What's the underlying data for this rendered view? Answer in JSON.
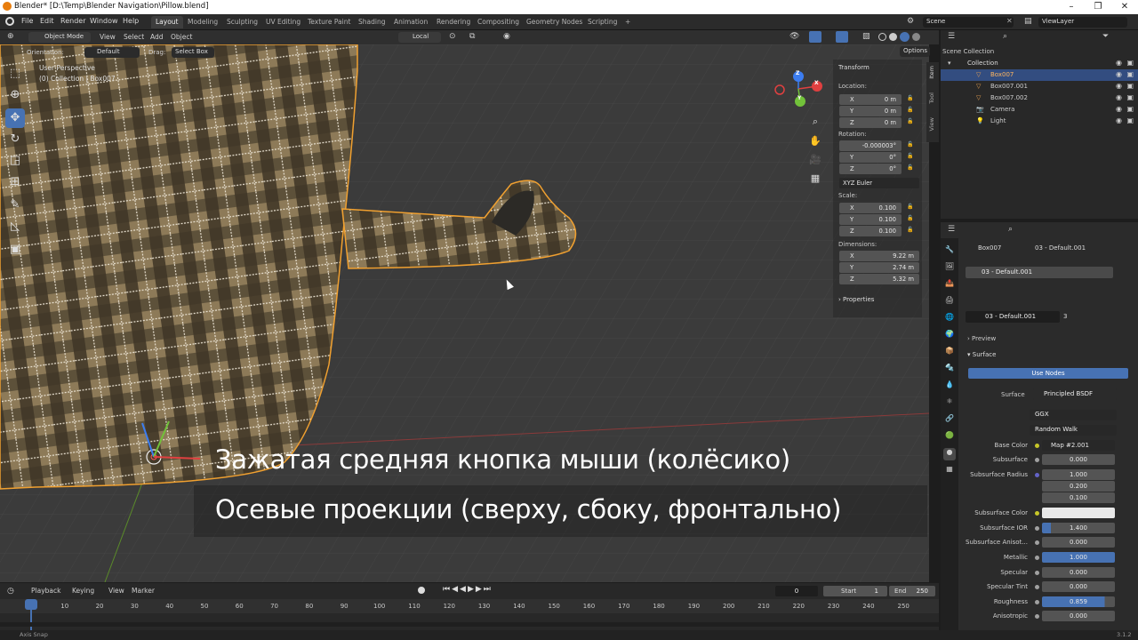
{
  "window": {
    "title": "Blender* [D:\\Temp\\Blender Navigation\\Pillow.blend]"
  },
  "menu": {
    "items": [
      "File",
      "Edit",
      "Render",
      "Window",
      "Help"
    ]
  },
  "workspaces": [
    "Layout",
    "Modeling",
    "Sculpting",
    "UV Editing",
    "Texture Paint",
    "Shading",
    "Animation",
    "Rendering",
    "Compositing",
    "Geometry Nodes",
    "Scripting"
  ],
  "topbar": {
    "add_tab": "+",
    "scene": "Scene",
    "view_layer": "ViewLayer"
  },
  "viewport_header": {
    "mode": "Object Mode",
    "menus": [
      "View",
      "Select",
      "Add",
      "Object"
    ],
    "transform_orientation": "Local",
    "orientation_label": "Orientation:",
    "orientation_value": "Default",
    "drag_label": "Drag:",
    "drag_value": "Select Box",
    "options": "Options"
  },
  "viewport": {
    "perspective": "User Perspective",
    "collection_info": "(0) Collection | Box007",
    "gizmo_axes": {
      "x": "X",
      "y": "Y",
      "z": "Z"
    }
  },
  "npanel": {
    "tabs": [
      "Item",
      "Tool",
      "View"
    ],
    "section": "Transform",
    "location_label": "Location:",
    "location": [
      {
        "axis": "X",
        "value": "0 m"
      },
      {
        "axis": "Y",
        "value": "0 m"
      },
      {
        "axis": "Z",
        "value": "0 m"
      }
    ],
    "rotation_label": "Rotation:",
    "rotation": [
      {
        "axis": "",
        "value": "-0.000003°"
      },
      {
        "axis": "Y",
        "value": "0°"
      },
      {
        "axis": "Z",
        "value": "0°"
      }
    ],
    "rotation_mode": "XYZ Euler",
    "scale_label": "Scale:",
    "scale": [
      {
        "axis": "X",
        "value": "0.100"
      },
      {
        "axis": "Y",
        "value": "0.100"
      },
      {
        "axis": "Z",
        "value": "0.100"
      }
    ],
    "dimensions_label": "Dimensions:",
    "dimensions": [
      {
        "axis": "X",
        "value": "9.22 m"
      },
      {
        "axis": "Y",
        "value": "2.74 m"
      },
      {
        "axis": "Z",
        "value": "5.32 m"
      }
    ],
    "properties": "Properties"
  },
  "outliner": {
    "root": "Scene Collection",
    "collection": "Collection",
    "items": [
      {
        "name": "Box007",
        "selected": true
      },
      {
        "name": "Box007.001",
        "selected": false
      },
      {
        "name": "Box007.002",
        "selected": false
      },
      {
        "name": "Camera",
        "selected": false
      },
      {
        "name": "Light",
        "selected": false
      }
    ]
  },
  "properties": {
    "breadcrumb_object": "Box007",
    "breadcrumb_material": "03 - Default.001",
    "slot": "03 - Default.001",
    "material_name": "03 - Default.001",
    "user_count": "3",
    "sections": {
      "preview": "Preview",
      "surface": "Surface"
    },
    "use_nodes": "Use Nodes",
    "surface_label": "Surface",
    "surface_shader": "Principled BSDF",
    "distribution": "GGX",
    "subsurface_method": "Random Walk",
    "rows": [
      {
        "label": "Base Color",
        "value": "Map #2.001"
      },
      {
        "label": "Subsurface",
        "value": "0.000"
      },
      {
        "label": "Subsurface Radius",
        "value": "1.000"
      },
      {
        "label": "",
        "value": "0.200"
      },
      {
        "label": "",
        "value": "0.100"
      },
      {
        "label": "Subsurface Color",
        "value": ""
      },
      {
        "label": "Subsurface IOR",
        "value": "1.400"
      },
      {
        "label": "Subsurface Anisot...",
        "value": "0.000"
      },
      {
        "label": "Metallic",
        "value": "1.000"
      },
      {
        "label": "Specular",
        "value": "0.000"
      },
      {
        "label": "Specular Tint",
        "value": "0.000"
      },
      {
        "label": "Roughness",
        "value": "0.859"
      },
      {
        "label": "Anisotropic",
        "value": "0.000"
      }
    ]
  },
  "timeline": {
    "menus": [
      "Playback",
      "Keying",
      "View",
      "Marker"
    ],
    "current_frame": "0",
    "start_label": "Start",
    "start": "1",
    "end_label": "End",
    "end": "250",
    "ticks": [
      "0",
      "10",
      "20",
      "30",
      "40",
      "50",
      "60",
      "70",
      "80",
      "90",
      "100",
      "110",
      "120",
      "130",
      "140",
      "150",
      "160",
      "170",
      "180",
      "190",
      "200",
      "210",
      "220",
      "230",
      "240",
      "250"
    ]
  },
  "status": {
    "left": "Axis Snap",
    "version": "3.1.2"
  },
  "subtitles": {
    "line1": "Зажатая средняя кнопка мыши (колёсико)",
    "line2": "Осевые проекции (сверху, сбоку, фронтально)"
  },
  "colors": {
    "accent": "#4772b3",
    "selection_outline": "#f0a030",
    "header": "#2f2f2f",
    "viewport_bg": "#3d3d3d"
  }
}
